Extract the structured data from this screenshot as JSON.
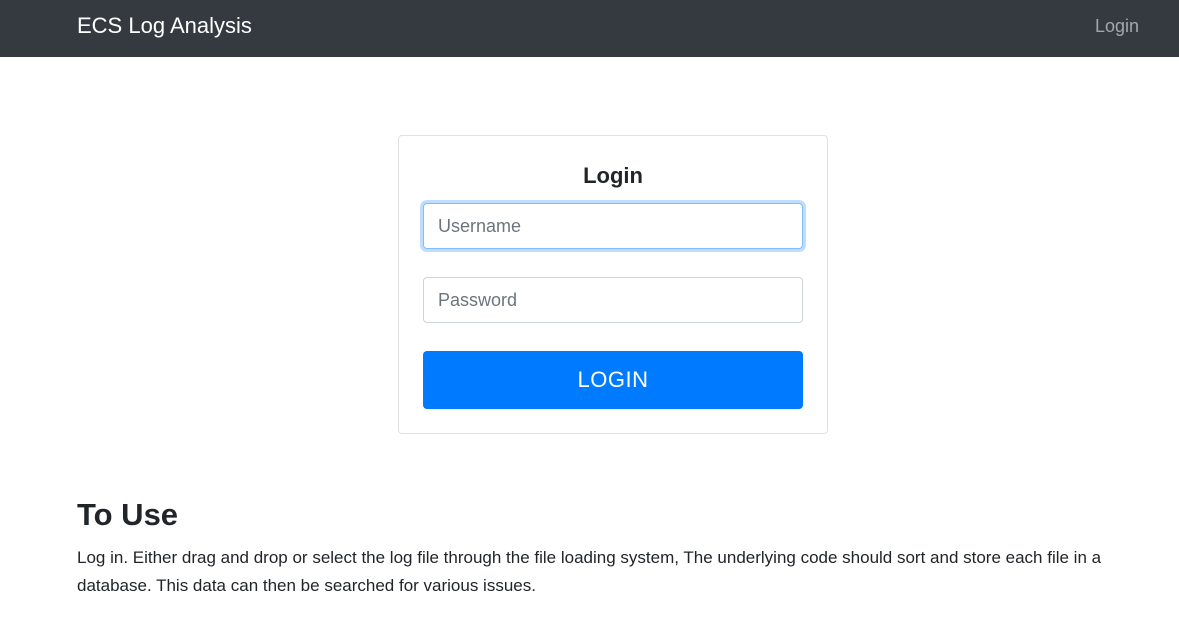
{
  "navbar": {
    "brand": "ECS Log Analysis",
    "login_link": "Login"
  },
  "login_card": {
    "title": "Login",
    "username": {
      "value": "",
      "placeholder": "Username"
    },
    "password": {
      "value": "",
      "placeholder": "Password"
    },
    "submit_label": "LOGIN"
  },
  "info": {
    "title": "To Use",
    "text": "Log in. Either drag and drop or select the log file through the file loading system, The underlying code should sort and store each file in a database. This data can then be searched for various issues."
  },
  "colors": {
    "navbar_bg": "#343a40",
    "primary": "#007bff",
    "focus_border": "#80bdff"
  }
}
